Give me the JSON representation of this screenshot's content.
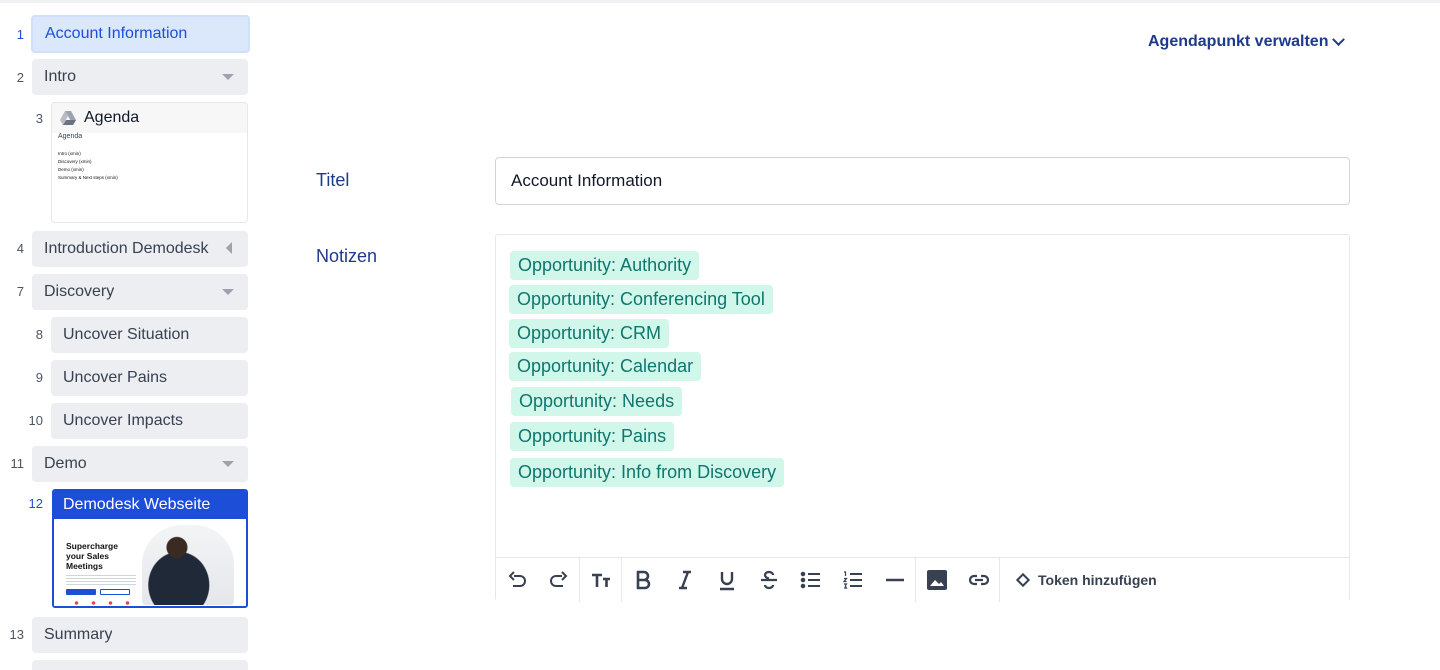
{
  "sidebar": {
    "items": [
      {
        "num": "1",
        "label": "Account Information"
      },
      {
        "num": "2",
        "label": "Intro"
      },
      {
        "num": "3",
        "label": "Agenda",
        "doc_title": "Agenda",
        "doc_lines": [
          "Intro (xmin)",
          "Discovery (xmin)",
          "Demo (xmin)",
          "Summary & Next steps (xmin)"
        ]
      },
      {
        "num": "4",
        "label": "Introduction Demodesk"
      },
      {
        "num": "7",
        "label": "Discovery"
      },
      {
        "num": "8",
        "label": "Uncover Situation"
      },
      {
        "num": "9",
        "label": "Uncover Pains"
      },
      {
        "num": "10",
        "label": "Uncover Impacts"
      },
      {
        "num": "11",
        "label": "Demo"
      },
      {
        "num": "12",
        "label": "Demodesk Webseite",
        "thumb_headline": "Supercharge your Sales Meetings"
      },
      {
        "num": "13",
        "label": "Summary"
      }
    ]
  },
  "header": {
    "manage_label": "Agendapunkt verwalten"
  },
  "form": {
    "title_label": "Titel",
    "title_value": "Account Information",
    "notes_label": "Notizen",
    "tokens": [
      "Opportunity: Authority",
      "Opportunity: Conferencing Tool",
      "Opportunity: CRM",
      "Opportunity: Calendar",
      "Opportunity: Needs",
      "Opportunity: Pains",
      "Opportunity: Info from Discovery"
    ],
    "toolbar": {
      "add_token_label": "Token hinzufügen",
      "icons": [
        "undo-icon",
        "redo-icon",
        "text-size-icon",
        "bold-icon",
        "italic-icon",
        "underline-icon",
        "strikethrough-icon",
        "bullet-list-icon",
        "numbered-list-icon",
        "horizontal-rule-icon",
        "image-icon",
        "link-icon"
      ]
    }
  },
  "colors": {
    "accent": "#1d4ed8",
    "label_navy": "#1e3a8a",
    "token_bg": "#d1f7ea",
    "token_text": "#0f766e"
  }
}
